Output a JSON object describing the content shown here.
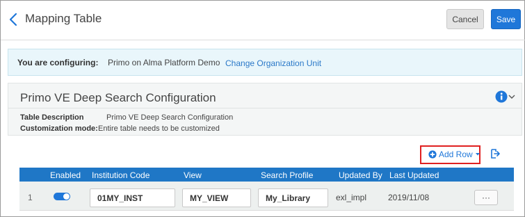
{
  "header": {
    "title": "Mapping Table",
    "cancel_label": "Cancel",
    "save_label": "Save"
  },
  "config": {
    "label": "You are configuring:",
    "value": "Primo on Alma Platform Demo",
    "link": "Change Organization Unit"
  },
  "section": {
    "title": "Primo VE Deep Search Configuration",
    "desc_label": "Table Description",
    "desc_value": "Primo VE Deep Search Configuration",
    "mode_label": "Customization mode:",
    "mode_value": "Entire table needs to be customized"
  },
  "toolbar": {
    "add_row_label": "Add Row"
  },
  "table": {
    "columns": [
      "Enabled",
      "Institution Code",
      "View",
      "Search Profile",
      "Updated By",
      "Last Updated"
    ],
    "rows": [
      {
        "num": "1",
        "enabled": true,
        "institution_code": "01MY_INST",
        "view": "MY_VIEW",
        "search_profile": "My_Library",
        "updated_by": "exl_impl",
        "last_updated": "2019/11/08",
        "actions_label": "···"
      }
    ]
  },
  "colors": {
    "accent": "#1f77d9",
    "table_header": "#1f77c6",
    "banner_bg": "#e9f6fb",
    "highlight_border": "#e02020"
  }
}
